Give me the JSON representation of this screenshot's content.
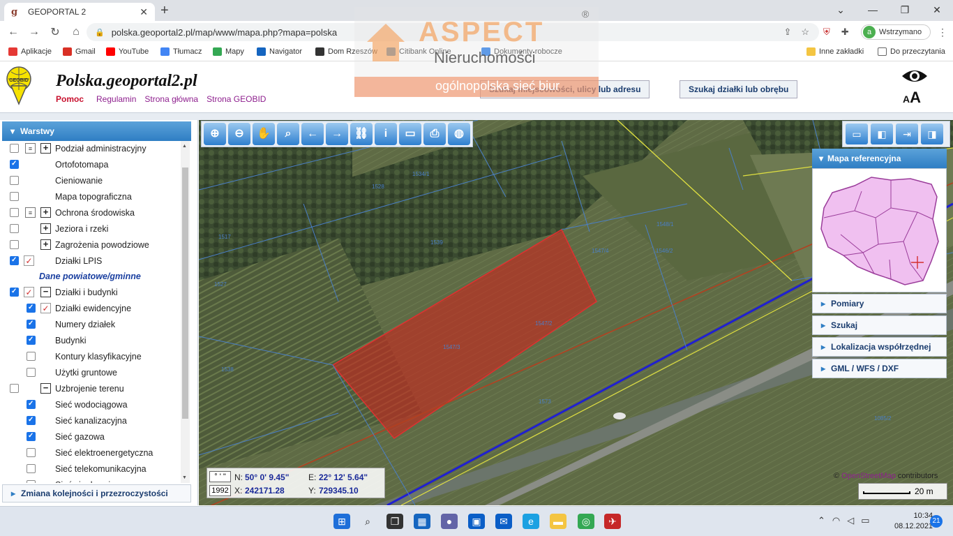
{
  "browser": {
    "tab_title": "GEOPORTAL 2",
    "url": "polska.geoportal2.pl/map/www/mapa.php?mapa=polska",
    "profile_label": "Wstrzymano",
    "profile_initial": "a",
    "bookmarks": [
      {
        "label": "Aplikacje",
        "color": "#e53935"
      },
      {
        "label": "Gmail",
        "color": "#d93025"
      },
      {
        "label": "YouTube",
        "color": "#ff0000"
      },
      {
        "label": "Tłumacz",
        "color": "#4285f4"
      },
      {
        "label": "Mapy",
        "color": "#34a853"
      },
      {
        "label": "Navigator",
        "color": "#1565c0"
      },
      {
        "label": "Dom Rzeszów",
        "color": "#333333"
      },
      {
        "label": "Citibank Online",
        "color": "#1e88e5"
      },
      {
        "label": "Dokumenty robocze",
        "color": "#1a73e8"
      }
    ],
    "other_bookmarks": "Inne zakładki",
    "reading_list": "Do przeczytania"
  },
  "header": {
    "site_title": "Polska.geoportal2.pl",
    "links": {
      "help": "Pomoc",
      "rules": "Regulamin",
      "home": "Strona główna",
      "geobid": "Strona GEOBID"
    },
    "search_address": "Szukaj miejscowości, ulicy lub adresu",
    "search_parcel": "Szukaj działki lub obrębu",
    "font_size_label": "A",
    "font_size_small": "A",
    "logo_text": "GEOBID"
  },
  "watermark": {
    "brand": "ASPECT",
    "registered": "®",
    "line1": "Nieruchomości",
    "line2": "ogólnopolska sieć biur"
  },
  "layers_panel": {
    "title": "Warstwy",
    "section_label": "Dane powiatowe/gminne",
    "footer": "Zmiana kolejności i przezroczystości",
    "items": [
      {
        "label": "Podział administracyjny",
        "checked": false,
        "doc": true,
        "expand": "+"
      },
      {
        "label": "Ortofotomapa",
        "checked": true
      },
      {
        "label": "Cieniowanie",
        "checked": false
      },
      {
        "label": "Mapa topograficzna",
        "checked": false
      },
      {
        "label": "Ochrona środowiska",
        "checked": false,
        "doc": true,
        "expand": "+"
      },
      {
        "label": "Jeziora i rzeki",
        "checked": false,
        "expand": "+"
      },
      {
        "label": "Zagrożenia powodziowe",
        "checked": false,
        "expand": "+"
      },
      {
        "label": "Działki LPIS",
        "checked": true,
        "legend": true
      },
      {
        "label": "Działki i budynki",
        "checked": true,
        "legend": true,
        "expand": "−"
      },
      {
        "label": "Działki ewidencyjne",
        "checked": true,
        "legend": true,
        "indent": true
      },
      {
        "label": "Numery działek",
        "checked": true,
        "indent": true
      },
      {
        "label": "Budynki",
        "checked": true,
        "indent": true
      },
      {
        "label": "Kontury klasyfikacyjne",
        "checked": false,
        "indent": true
      },
      {
        "label": "Użytki gruntowe",
        "checked": false,
        "indent": true
      },
      {
        "label": "Uzbrojenie terenu",
        "checked": false,
        "expand": "−"
      },
      {
        "label": "Sieć wodociągowa",
        "checked": true,
        "indent": true
      },
      {
        "label": "Sieć kanalizacyjna",
        "checked": true,
        "indent": true
      },
      {
        "label": "Sieć gazowa",
        "checked": true,
        "indent": true
      },
      {
        "label": "Sieć elektroenergetyczna",
        "checked": false,
        "indent": true
      },
      {
        "label": "Sieć telekomunikacyjna",
        "checked": false,
        "indent": true
      },
      {
        "label": "Sieć ciepłownicza",
        "checked": false,
        "indent": true
      }
    ]
  },
  "map": {
    "tools": [
      "zoom-in",
      "zoom-out",
      "pan",
      "zoom-box",
      "back",
      "forward",
      "link",
      "info",
      "measure",
      "print",
      "globe"
    ],
    "parcel_labels": [
      "1534/1",
      "1528",
      "1517",
      "1527",
      "1539",
      "1547/4",
      "1546/2",
      "1548/1",
      "1547/2",
      "1547/3",
      "1546/2",
      "1538",
      "1573",
      "1085/2"
    ],
    "ref_panel_title": "Mapa referencyjna",
    "side_items": [
      "Pomiary",
      "Szukaj",
      "Lokalizacja współrzędnej",
      "GML / WFS / DXF"
    ],
    "coords": {
      "unit_deg": "° ' \"",
      "unit_sys": "1992",
      "n_label": "N:",
      "n_value": "50° 0' 9.45\"",
      "e_label": "E:",
      "e_value": "22° 12' 5.64\"",
      "x_label": "X:",
      "x_value": "242171.28",
      "y_label": "Y:",
      "y_value": "729345.10"
    },
    "attribution_prefix": "©",
    "attribution_osm": "OpenStreetMap",
    "attribution_suffix": "contributors",
    "scale": "20 m"
  },
  "taskbar": {
    "time": "10:34",
    "date": "08.12.2021",
    "notifications": "21"
  }
}
